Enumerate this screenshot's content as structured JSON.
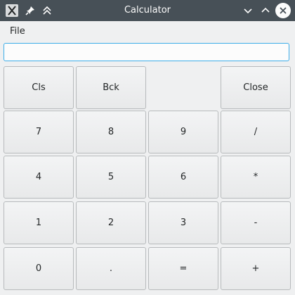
{
  "window": {
    "title": "Calculator"
  },
  "menu": {
    "file": "File"
  },
  "display": {
    "value": ""
  },
  "buttons": {
    "cls": "Cls",
    "bck": "Bck",
    "close": "Close",
    "n7": "7",
    "n8": "8",
    "n9": "9",
    "div": "/",
    "n4": "4",
    "n5": "5",
    "n6": "6",
    "mul": "*",
    "n1": "1",
    "n2": "2",
    "n3": "3",
    "sub": "-",
    "n0": "0",
    "dot": ".",
    "eq": "=",
    "add": "+"
  },
  "colors": {
    "titlebar": "#475057",
    "focus": "#3daee9",
    "window_bg": "#eff0f1"
  },
  "icons": [
    "app-icon",
    "pin-icon",
    "keep-above-icon",
    "minimize-icon",
    "maximize-icon",
    "close-window-icon"
  ]
}
